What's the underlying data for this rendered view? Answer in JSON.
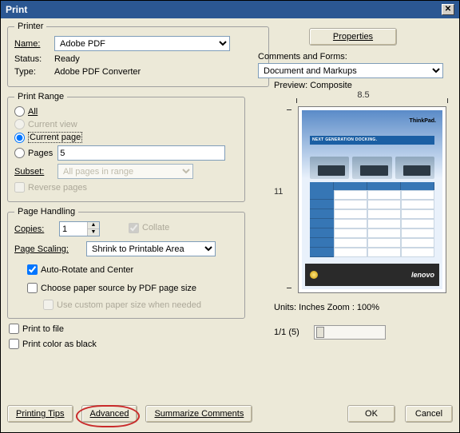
{
  "window": {
    "title": "Print"
  },
  "printer": {
    "legend": "Printer",
    "name_label": "Name:",
    "name_value": "Adobe PDF",
    "status_label": "Status:",
    "status_value": "Ready",
    "type_label": "Type:",
    "type_value": "Adobe PDF Converter",
    "properties_btn": "Properties",
    "comments_label": "Comments and Forms:",
    "comments_value": "Document and Markups"
  },
  "range": {
    "legend": "Print Range",
    "all": "All",
    "current_view": "Current view",
    "current_page": "Current page",
    "pages_label": "Pages",
    "pages_value": "5",
    "subset_label": "Subset:",
    "subset_value": "All pages in range",
    "reverse": "Reverse pages"
  },
  "handling": {
    "legend": "Page Handling",
    "copies_label": "Copies:",
    "copies_value": "1",
    "collate": "Collate",
    "scaling_label": "Page Scaling:",
    "scaling_value": "Shrink to Printable Area",
    "auto_rotate": "Auto-Rotate and Center",
    "choose_source": "Choose paper source by PDF page size",
    "custom_paper": "Use custom paper size when needed"
  },
  "options": {
    "print_to_file": "Print to file",
    "print_black": "Print color as black"
  },
  "preview": {
    "label": "Preview: Composite",
    "width": "8.5",
    "height": "11",
    "units_zoom": "Units: Inches Zoom : 100%",
    "page_info": "1/1 (5)",
    "doc_banner": "NEXT GENERATION DOCKING.",
    "brand": "ThinkPad.",
    "footer_brand": "lenovo"
  },
  "buttons": {
    "tips": "Printing Tips",
    "advanced": "Advanced",
    "summarize": "Summarize Comments",
    "ok": "OK",
    "cancel": "Cancel"
  },
  "chart_data": {
    "type": "table",
    "title": "NEXT GENERATION DOCKING.",
    "note": "Preview thumbnail; cell contents not legible at this resolution",
    "columns": 3,
    "rows": 7
  }
}
